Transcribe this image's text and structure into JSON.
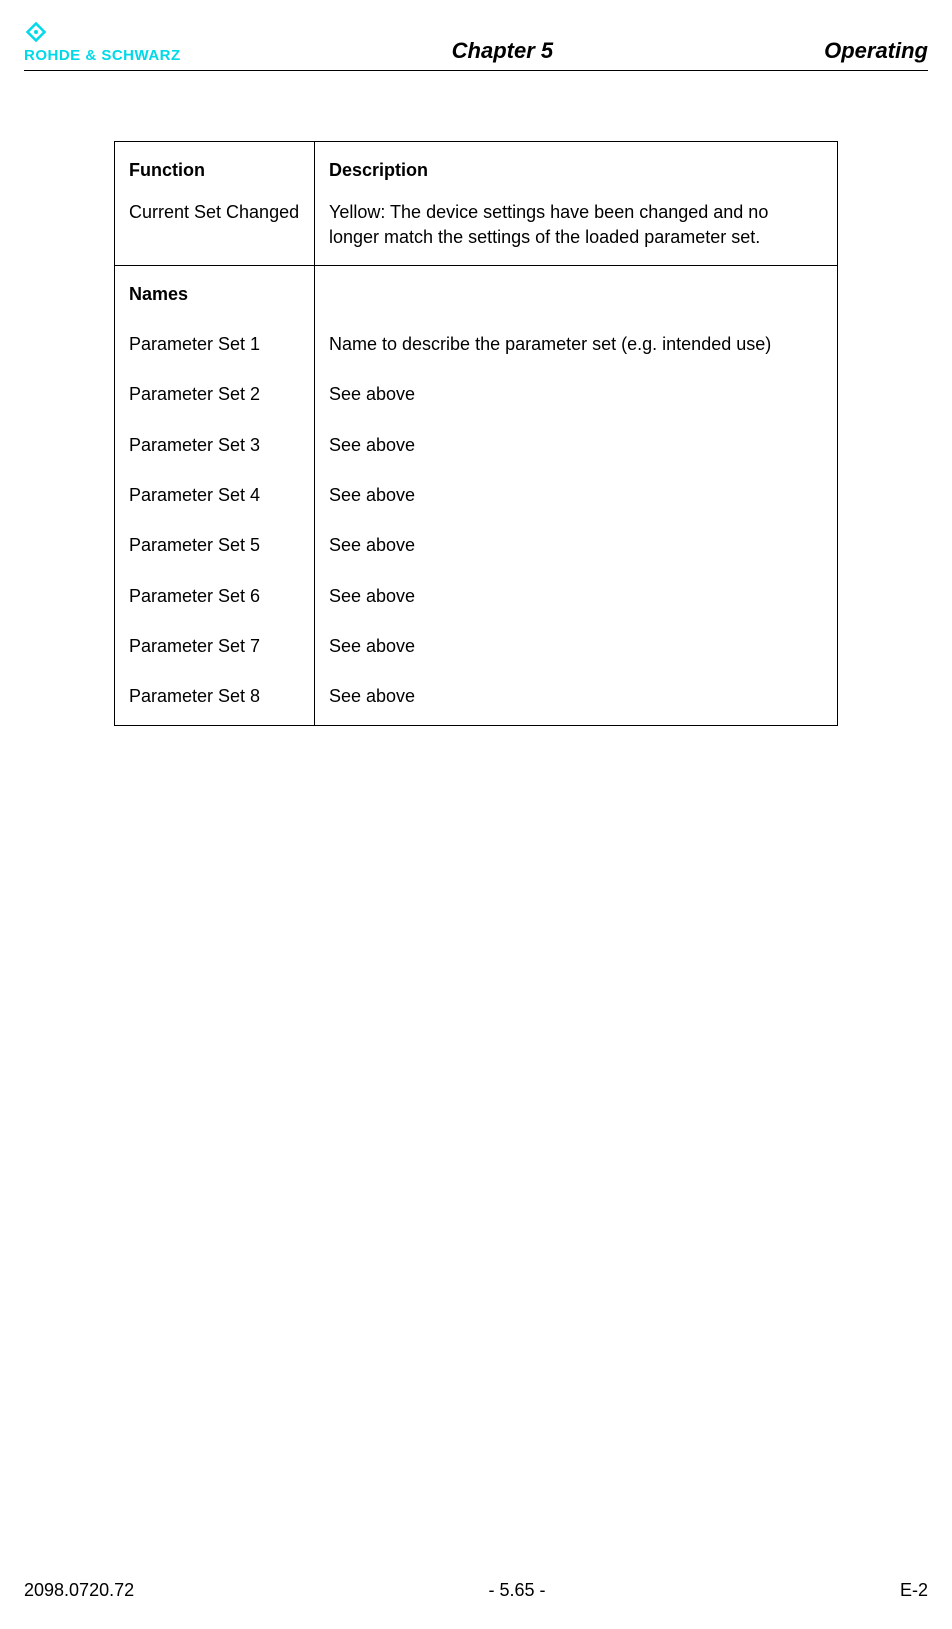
{
  "header": {
    "logo_text": "ROHDE & SCHWARZ",
    "chapter": "Chapter 5",
    "section": "Operating"
  },
  "table": {
    "col1_header": "Function",
    "col2_header": "Description",
    "row1": {
      "func": "Current Set Changed",
      "desc": "Yellow: The device settings have been changed and no longer match the settings of the loaded parameter set."
    },
    "names_header": "Names",
    "params": [
      {
        "label": "Parameter Set 1",
        "desc": "Name to describe the parameter set (e.g. intended use)"
      },
      {
        "label": "Parameter Set 2",
        "desc": "See above"
      },
      {
        "label": "Parameter Set 3",
        "desc": "See above"
      },
      {
        "label": "Parameter Set 4",
        "desc": "See above"
      },
      {
        "label": "Parameter Set 5",
        "desc": "See above"
      },
      {
        "label": "Parameter Set 6",
        "desc": "See above"
      },
      {
        "label": "Parameter Set 7",
        "desc": "See above"
      },
      {
        "label": "Parameter Set 8",
        "desc": "See above"
      }
    ]
  },
  "footer": {
    "left": "2098.0720.72",
    "center": "- 5.65 -",
    "right": "E-2"
  }
}
